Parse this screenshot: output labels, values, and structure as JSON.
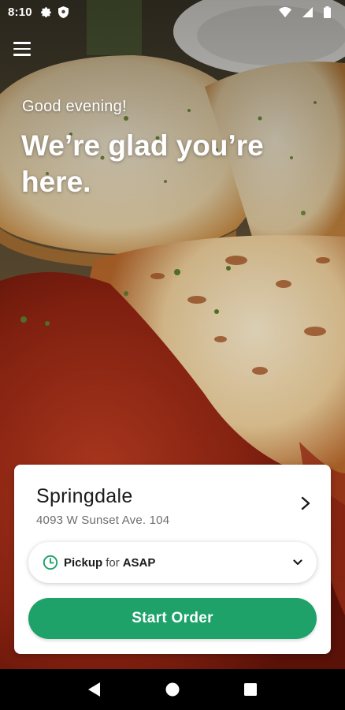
{
  "status_bar": {
    "time": "8:10",
    "icons": [
      "settings-icon",
      "shield-icon",
      "wifi-icon",
      "signal-icon",
      "battery-icon"
    ]
  },
  "hero": {
    "greeting": "Good evening!",
    "headline": "We’re glad you’re here."
  },
  "location": {
    "name": "Springdale",
    "address": "4093 W Sunset Ave. 104"
  },
  "order_mode": {
    "label": "Pickup",
    "connector": "for",
    "time": "ASAP"
  },
  "start_button": {
    "label": "Start Order"
  },
  "colors": {
    "accent": "#1ea26a",
    "card": "#ffffff",
    "navbar": "#000000"
  }
}
